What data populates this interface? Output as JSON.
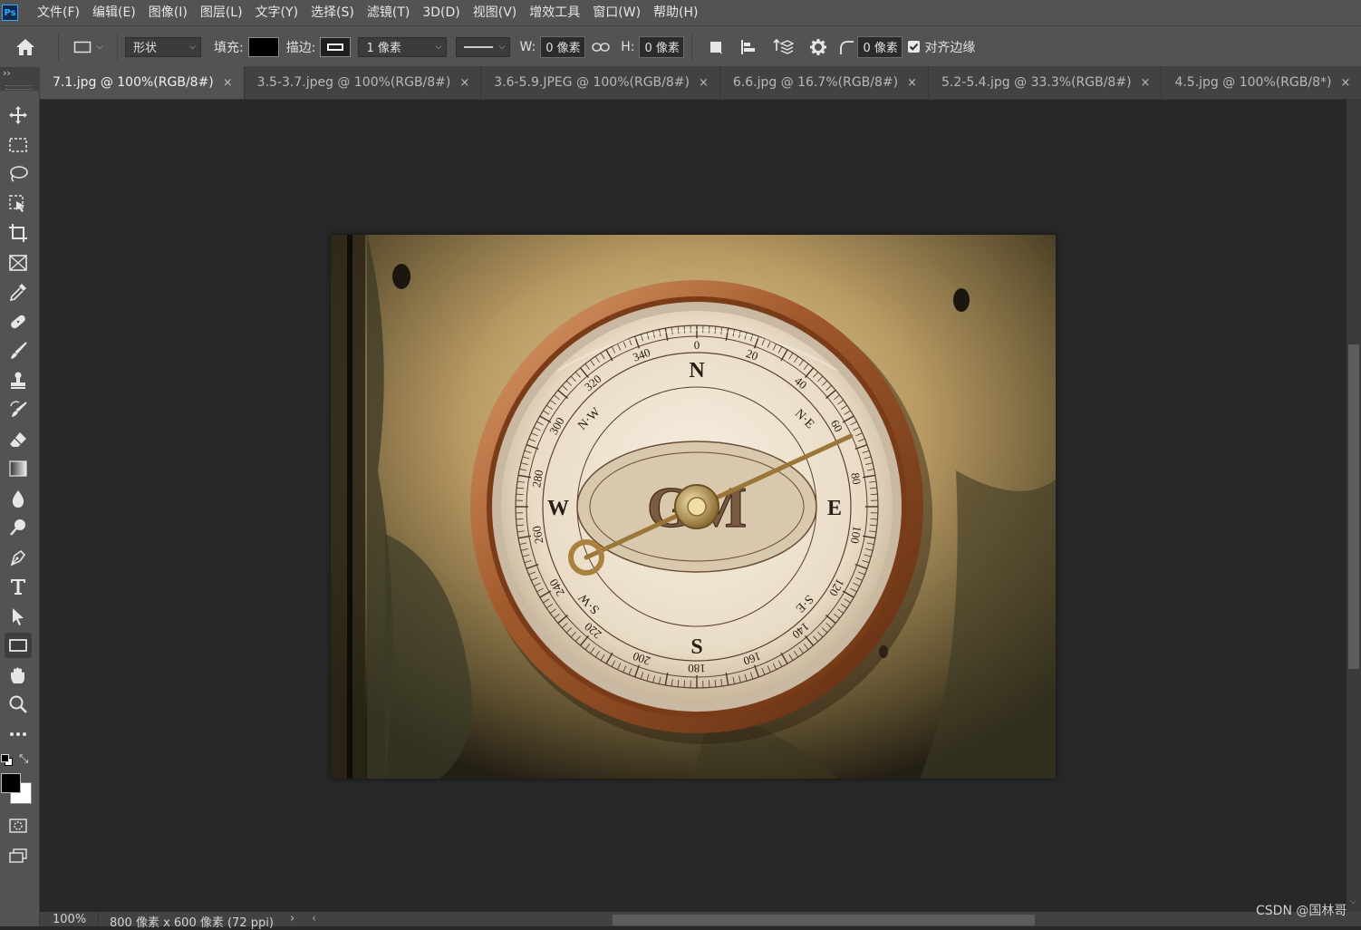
{
  "app": {
    "logo": "Ps"
  },
  "menu": [
    "文件(F)",
    "编辑(E)",
    "图像(I)",
    "图层(L)",
    "文字(Y)",
    "选择(S)",
    "滤镜(T)",
    "3D(D)",
    "视图(V)",
    "增效工具",
    "窗口(W)",
    "帮助(H)"
  ],
  "options": {
    "mode_select": "形状",
    "fill_label": "填充:",
    "stroke_label": "描边:",
    "stroke_width": "1 像素",
    "w_label": "W:",
    "w_value": "0 像素",
    "h_label": "H:",
    "h_value": "0 像素",
    "radius_value": "0 像素",
    "align_edges_label": "对齐边缘",
    "align_edges_checked": true
  },
  "tabs": [
    {
      "label": "7.1.jpg @ 100%(RGB/8#)",
      "active": true
    },
    {
      "label": "3.5-3.7.jpeg @ 100%(RGB/8#)",
      "active": false
    },
    {
      "label": "3.6-5.9.JPEG @ 100%(RGB/8#)",
      "active": false
    },
    {
      "label": "6.6.jpg @ 16.7%(RGB/8#)",
      "active": false
    },
    {
      "label": "5.2-5.4.jpg @ 33.3%(RGB/8#)",
      "active": false
    },
    {
      "label": "4.5.jpg @ 100%(RGB/8*)",
      "active": false
    }
  ],
  "tab_close": "×",
  "tools": [
    "move-tool-icon",
    "marquee-tool-icon",
    "lasso-tool-icon",
    "object-select-tool-icon",
    "crop-tool-icon",
    "frame-tool-icon",
    "eyedropper-tool-icon",
    "healing-brush-tool-icon",
    "brush-tool-icon",
    "clone-stamp-tool-icon",
    "history-brush-tool-icon",
    "eraser-tool-icon",
    "gradient-tool-icon",
    "blur-tool-icon",
    "dodge-tool-icon",
    "pen-tool-icon",
    "type-tool-icon",
    "path-select-tool-icon",
    "rectangle-tool-icon",
    "hand-tool-icon",
    "zoom-tool-icon",
    "more-tools-icon"
  ],
  "compass": {
    "cardinals": [
      "N",
      "E",
      "S",
      "W"
    ],
    "intercardinals": [
      "N·E",
      "S·E",
      "S·W",
      "N·W"
    ],
    "degrees": [
      "0",
      "20",
      "40",
      "60",
      "80",
      "100",
      "120",
      "140",
      "160",
      "180",
      "200",
      "220",
      "240",
      "260",
      "280",
      "300",
      "320",
      "340"
    ],
    "monogram": "GM"
  },
  "status": {
    "zoom": "100%",
    "doc_info": "800 像素 x 600 像素 (72 ppi)",
    "arrow": "›",
    "scroll_left": "‹"
  },
  "watermark": "CSDN @国林哥",
  "colors": {
    "foreground": "#000000",
    "background": "#ffffff",
    "accent": "#31a8ff"
  }
}
